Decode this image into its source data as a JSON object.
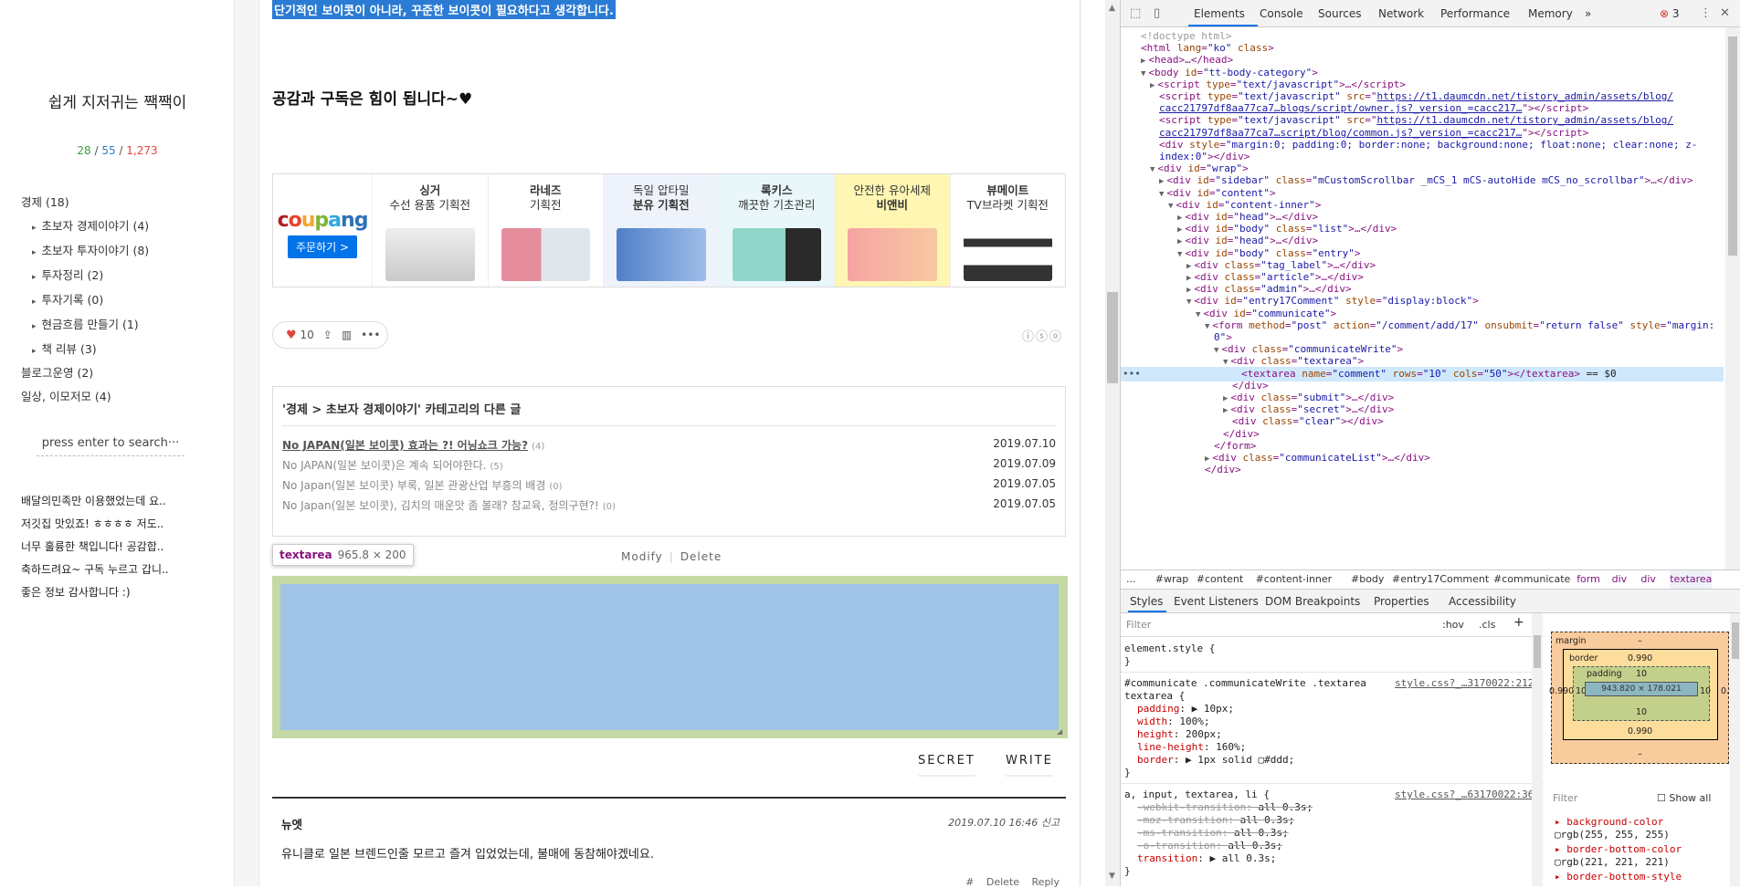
{
  "blog": {
    "title": "쉽게 지저귀는 짹짹이",
    "stats": {
      "today": "28",
      "yesterday": "55",
      "total": "1,273",
      "sep": "/"
    },
    "categories": [
      {
        "label": "경제 (18)"
      },
      {
        "label": "초보자 경제이야기 (4)"
      },
      {
        "label": "초보자 투자이야기 (8)"
      },
      {
        "label": "투자정리 (2)"
      },
      {
        "label": "투자기록 (0)"
      },
      {
        "label": "현금흐름 만들기 (1)"
      },
      {
        "label": "책 리뷰 (3)"
      },
      {
        "label": "블로그운영 (2)"
      },
      {
        "label": "일상, 이모저모 (4)"
      }
    ],
    "search_placeholder": "press enter to search···",
    "recent_comments": [
      "배달의민족만 이용했었는데 요..",
      "저깃집 맛있죠! ㅎㅎㅎㅎ 저도..",
      "너무 훌륭한 책입니다! 공감합..",
      "축하드려요~ 구독 누르고 갑니..",
      "좋은 정보 감사합니다 :)"
    ]
  },
  "post": {
    "highlight_text": "단기적인 보이콧이 아니라, 꾸준한 보이콧이 필요하다고 생각합니다.",
    "support_text": "공감과 구독은 힘이 됩니다~♥",
    "banner": {
      "logo": "coupang",
      "order_button": "주문하기 >",
      "items": [
        {
          "t1": "싱거",
          "t2": "수선 용품 기획전",
          "color": "#d9d9d9"
        },
        {
          "t1": "라네즈",
          "t2": "기획전",
          "color": "#e8aab4"
        },
        {
          "t1": "독일 압타밀",
          "t2": "분유 기획전",
          "color": "#6e98d6",
          "bg": "#eef3fb"
        },
        {
          "t1": "록키스",
          "t2": "깨끗한 기초관리",
          "color": "#7ecfc2",
          "bg": "#e9f7fb"
        },
        {
          "t1": "안전한 유아세제",
          "t2": "비앤비",
          "color": "#f5a0a0",
          "bg": "#fff6b3"
        },
        {
          "t1": "뷰메이트",
          "t2": "TV브라켓 기획전",
          "color": "#333333"
        }
      ]
    },
    "likes": "10",
    "related": {
      "title": "'경제 > 초보자 경제이야기' 카테고리의 다른 글",
      "items": [
        {
          "title": "No JAPAN(일본 보이콧) 효과는 ?! 어닝쇼크 가능?",
          "count": "(4)",
          "date": "2019.07.10"
        },
        {
          "title": "No JAPAN(일본 보이콧)은 계속 되어야한다.",
          "count": "(5)",
          "date": "2019.07.09"
        },
        {
          "title": "No Japan(일본 보이콧) 부록, 일본 관광산업 부흥의 배경",
          "count": "(0)",
          "date": "2019.07.05"
        },
        {
          "title": "No Japan(일본 보이콧), 김치의 매운맛 좀 볼래? 참교육, 정의구현?!",
          "count": "(0)",
          "date": "2019.07.05"
        }
      ]
    },
    "tooltip": {
      "tag": "textarea",
      "size": "965.8 × 200"
    },
    "modify": "Modify",
    "delete": "Delete",
    "secret": "SECRET",
    "write": "WRITE",
    "comment": {
      "author": "뉴엣",
      "date": "2019.07.10 16:46 신고",
      "text": "유니클로 일본 브렌드인줄 모르고 즐겨 입었었는데, 불매에 동참해야겠네요.",
      "actions": "# Delete Reply"
    }
  },
  "devtools": {
    "tabs": [
      "Elements",
      "Console",
      "Sources",
      "Network",
      "Performance",
      "Memory"
    ],
    "more": "»",
    "errors": "3",
    "dom_lines": [
      {
        "i": 0,
        "html": "<span class='c' style='color:#999'>&lt;!doctype html&gt;</span>"
      },
      {
        "i": 0,
        "html": "&lt;html <span class='a'>lang</span>=<span class='v'>\"ko\"</span> <span class='a'>class</span>&gt;"
      },
      {
        "i": 1,
        "tri": "▶",
        "html": "&lt;head&gt;…&lt;/head&gt;"
      },
      {
        "i": 1,
        "tri": "▼",
        "html": "&lt;body <span class='a'>id</span>=<span class='v'>\"tt-body-category\"</span>&gt;"
      },
      {
        "i": 2,
        "tri": "▶",
        "html": "&lt;script <span class='a'>type</span>=<span class='v'>\"text/javascript\"</span>&gt;…&lt;/script&gt;"
      },
      {
        "i": 2,
        "html": "&lt;script <span class='a'>type</span>=<span class='v'>\"text/javascript\"</span> <span class='a'>src</span>=\"<span class='u'>https://t1.daumcdn.net/tistory_admin/assets/blog/</span>"
      },
      {
        "i": 2,
        "html": "<span class='u'>cacc21797df8aa77ca7…blogs/script/owner.js?_version_=cacc217…</span>\"&gt;&lt;/script&gt;"
      },
      {
        "i": 2,
        "html": "&lt;script <span class='a'>type</span>=<span class='v'>\"text/javascript\"</span> <span class='a'>src</span>=\"<span class='u'>https://t1.daumcdn.net/tistory_admin/assets/blog/</span>"
      },
      {
        "i": 2,
        "html": "<span class='u'>cacc21797df8aa77ca7…script/blog/common.js?_version_=cacc217…</span>\"&gt;&lt;/script&gt;"
      },
      {
        "i": 2,
        "html": "&lt;div <span class='a'>style</span>=<span class='v'>\"margin:0; padding:0; border:none; background:none; float:none; clear:none; z-</span>"
      },
      {
        "i": 2,
        "html": "<span class='v'>index:0\"</span>&gt;&lt;/div&gt;"
      },
      {
        "i": 2,
        "tri": "▼",
        "html": "&lt;div <span class='a'>id</span>=<span class='v'>\"wrap\"</span>&gt;"
      },
      {
        "i": 3,
        "tri": "▶",
        "html": "&lt;div <span class='a'>id</span>=<span class='v'>\"sidebar\"</span> <span class='a'>class</span>=<span class='v'>\"mCustomScrollbar _mCS_1 mCS-autoHide mCS_no_scrollbar\"</span>&gt;…&lt;/div&gt;"
      },
      {
        "i": 3,
        "tri": "▼",
        "html": "&lt;div <span class='a'>id</span>=<span class='v'>\"content\"</span>&gt;"
      },
      {
        "i": 4,
        "tri": "▼",
        "html": "&lt;div <span class='a'>id</span>=<span class='v'>\"content-inner\"</span>&gt;"
      },
      {
        "i": 5,
        "tri": "▶",
        "html": "&lt;div <span class='a'>id</span>=<span class='v'>\"head\"</span>&gt;…&lt;/div&gt;"
      },
      {
        "i": 5,
        "tri": "▶",
        "html": "&lt;div <span class='a'>id</span>=<span class='v'>\"body\"</span> <span class='a'>class</span>=<span class='v'>\"list\"</span>&gt;…&lt;/div&gt;"
      },
      {
        "i": 5,
        "tri": "▶",
        "html": "&lt;div <span class='a'>id</span>=<span class='v'>\"head\"</span>&gt;…&lt;/div&gt;"
      },
      {
        "i": 5,
        "tri": "▼",
        "html": "&lt;div <span class='a'>id</span>=<span class='v'>\"body\"</span> <span class='a'>class</span>=<span class='v'>\"entry\"</span>&gt;"
      },
      {
        "i": 6,
        "tri": "▶",
        "html": "&lt;div <span class='a'>class</span>=<span class='v'>\"tag_label\"</span>&gt;…&lt;/div&gt;"
      },
      {
        "i": 6,
        "tri": "▶",
        "html": "&lt;div <span class='a'>class</span>=<span class='v'>\"article\"</span>&gt;…&lt;/div&gt;"
      },
      {
        "i": 6,
        "tri": "▶",
        "html": "&lt;div <span class='a'>class</span>=<span class='v'>\"admin\"</span>&gt;…&lt;/div&gt;"
      },
      {
        "i": 6,
        "tri": "▼",
        "html": "&lt;div <span class='a'>id</span>=<span class='v'>\"entry17Comment\"</span> <span class='a'>style</span>=<span class='v'>\"display:block\"</span>&gt;"
      },
      {
        "i": 7,
        "tri": "▼",
        "html": "&lt;div <span class='a'>id</span>=<span class='v'>\"communicate\"</span>&gt;"
      },
      {
        "i": 8,
        "tri": "▼",
        "html": "&lt;form <span class='a'>method</span>=<span class='v'>\"post\"</span> <span class='a'>action</span>=<span class='v'>\"/comment/add/17\"</span> <span class='a'>onsubmit</span>=<span class='v'>\"return false\"</span> <span class='a'>style</span>=<span class='v'>\"margin:</span>"
      },
      {
        "i": 8,
        "html": "<span class='v'>0\"</span>&gt;"
      },
      {
        "i": 9,
        "tri": "▼",
        "html": "&lt;div <span class='a'>class</span>=<span class='v'>\"communicateWrite\"</span>&gt;"
      },
      {
        "i": 10,
        "tri": "▼",
        "html": "&lt;div <span class='a'>class</span>=<span class='v'>\"textarea\"</span>&gt;"
      },
      {
        "i": 11,
        "html": "&lt;textarea <span class='a'>name</span>=<span class='v'>\"comment\"</span> <span class='a'>rows</span>=<span class='v'>\"10\"</span> <span class='a'>cols</span>=<span class='v'>\"50\"</span>&gt;&lt;/textarea&gt; <span class='tx'>== $0</span>"
      },
      {
        "i": 10,
        "html": "&lt;/div&gt;"
      },
      {
        "i": 10,
        "tri": "▶",
        "html": "&lt;div <span class='a'>class</span>=<span class='v'>\"submit\"</span>&gt;…&lt;/div&gt;"
      },
      {
        "i": 10,
        "tri": "▶",
        "html": "&lt;div <span class='a'>class</span>=<span class='v'>\"secret\"</span>&gt;…&lt;/div&gt;"
      },
      {
        "i": 10,
        "html": "&lt;div <span class='a'>class</span>=<span class='v'>\"clear\"</span>&gt;&lt;/div&gt;"
      },
      {
        "i": 9,
        "html": "&lt;/div&gt;"
      },
      {
        "i": 8,
        "html": "&lt;/form&gt;"
      },
      {
        "i": 8,
        "tri": "▶",
        "html": "&lt;div <span class='a'>class</span>=<span class='v'>\"communicateList\"</span>&gt;…&lt;/div&gt;"
      },
      {
        "i": 7,
        "html": "&lt;/div&gt;"
      }
    ],
    "selected_dots": "•••",
    "breadcrumbs": [
      "...",
      "#wrap",
      "#content",
      "#content-inner",
      "#body",
      "#entry17Comment",
      "#communicate",
      "form",
      "div",
      "div",
      "textarea"
    ],
    "subtabs": [
      "Styles",
      "Event Listeners",
      "DOM Breakpoints",
      "Properties",
      "Accessibility"
    ],
    "filter_placeholder": "Filter",
    "hov": ":hov",
    "cls": ".cls",
    "plus": "+",
    "styles": {
      "element_style_open": "element.style {",
      "close": "}",
      "rule1_selector": "#communicate .communicateWrite .textarea",
      "rule1_src": "style.css?_…3170022:212",
      "rule1_sel2": "textarea {",
      "rule1_props": [
        {
          "p": "padding",
          "v": "▶ 10px;"
        },
        {
          "p": "width",
          "v": "100%;"
        },
        {
          "p": "height",
          "v": "200px;"
        },
        {
          "p": "line-height",
          "v": "160%;"
        },
        {
          "p": "border",
          "v": "▶ 1px solid ▢#ddd;"
        }
      ],
      "rule2_selector": "a, input, textarea, li {",
      "rule2_src": "style.css?_…63170022:36",
      "rule2_props": [
        {
          "p": "-webkit-transition",
          "v": "all 0.3s;",
          "strike": true
        },
        {
          "p": "-moz-transition",
          "v": "all 0.3s;",
          "strike": true
        },
        {
          "p": "-ms-transition",
          "v": "all 0.3s;",
          "strike": true
        },
        {
          "p": "-o-transition",
          "v": "all 0.3s;",
          "strike": true
        },
        {
          "p": "transition",
          "v": "▶ all 0.3s;",
          "strike": false
        }
      ]
    },
    "boxmodel": {
      "margin": "margin",
      "margin_val": "–",
      "border": "border",
      "border_val": "0.990",
      "padding": "padding",
      "padding_val": "10",
      "content": "943.820 × 178.021",
      "side_pad": "10",
      "side_border": "0.990",
      "bottom_pad": "10",
      "bottom_border": "0.990",
      "bottom_margin": "–"
    },
    "computed_filter": "Filter",
    "show_all": "Show all",
    "computed": [
      {
        "p": "background-color",
        "v": "rgb(255, 255, 255)"
      },
      {
        "p": "border-bottom-color",
        "v": "rgb(221, 221, 221)"
      },
      {
        "p": "border-bottom-style",
        "v": ""
      }
    ]
  }
}
